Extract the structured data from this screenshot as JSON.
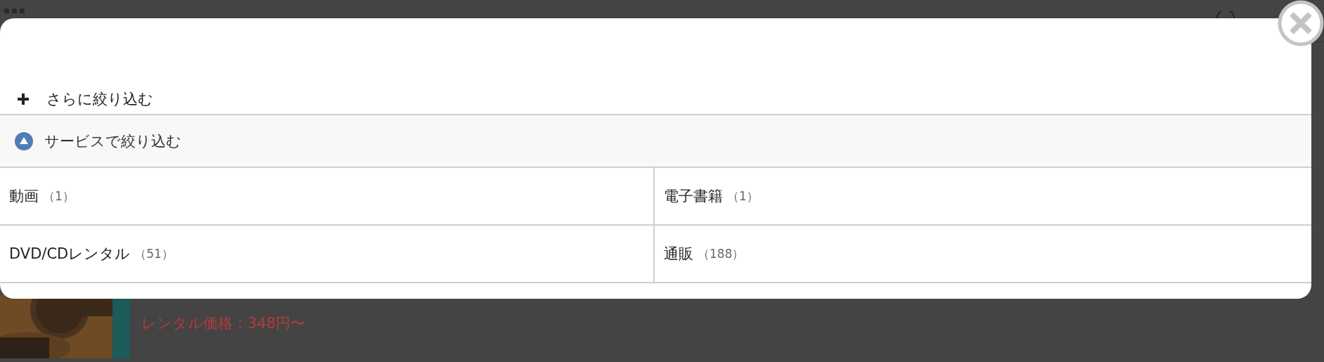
{
  "filter": {
    "more_label": "さらに絞り込む",
    "section": {
      "title": "サービスで絞り込む",
      "expanded": true
    },
    "services": [
      {
        "name": "動画",
        "count": "（1）"
      },
      {
        "name": "電子書籍",
        "count": "（1）"
      },
      {
        "name": "DVD/CDレンタル",
        "count": "（51）"
      },
      {
        "name": "通販",
        "count": "（188）"
      }
    ]
  },
  "background": {
    "price": "レンタル価格：348円〜"
  }
}
